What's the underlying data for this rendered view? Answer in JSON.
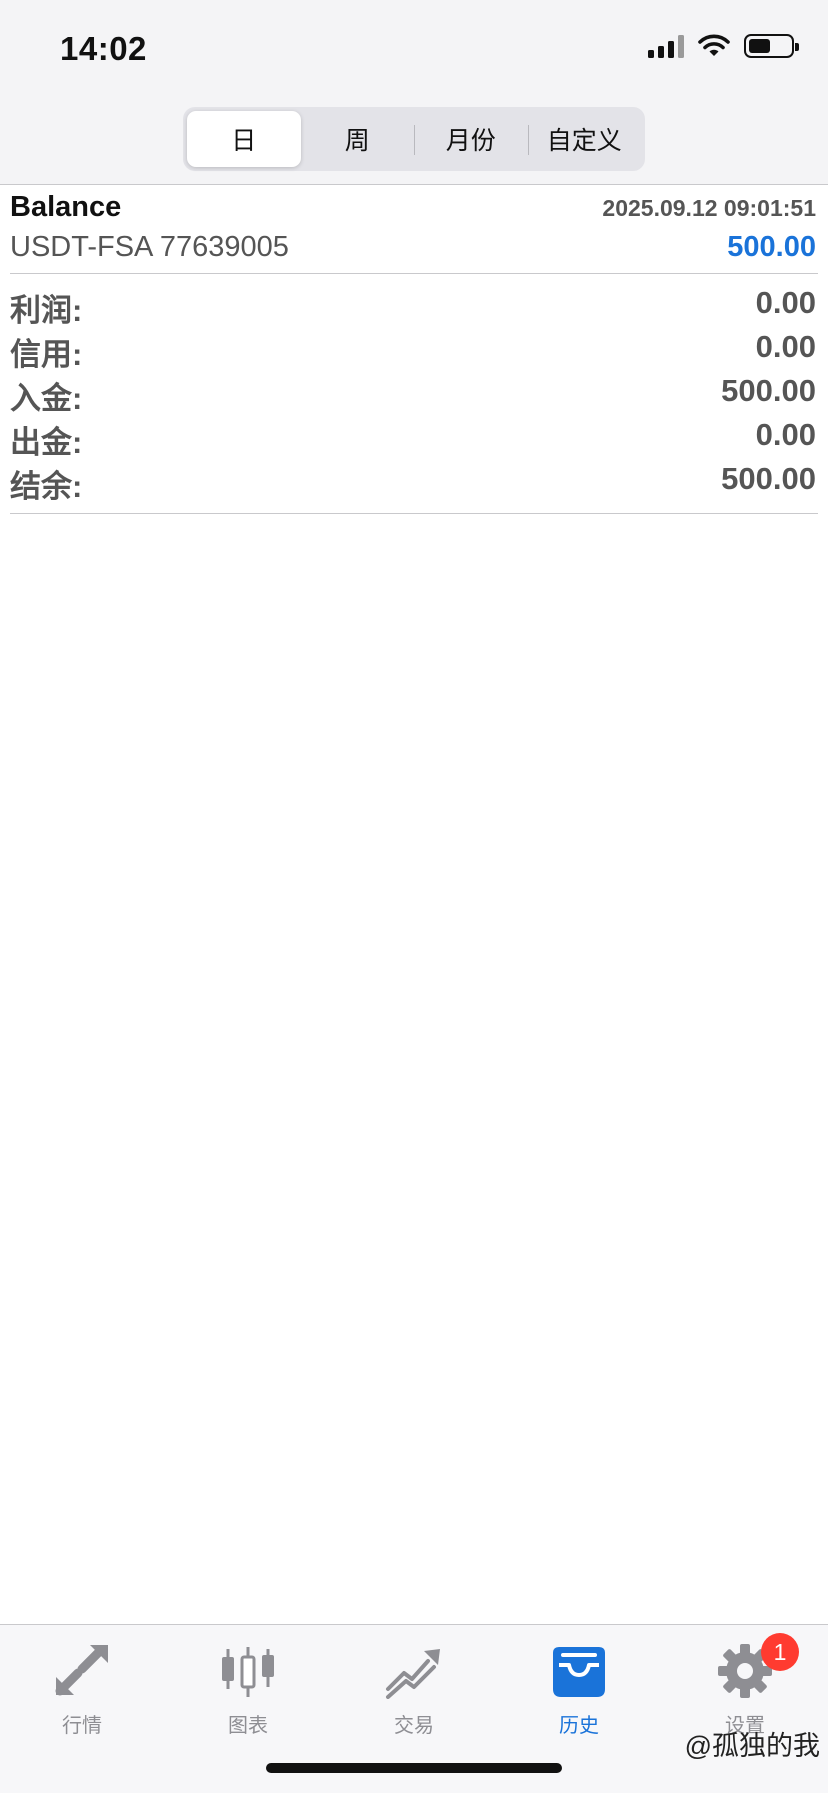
{
  "status_bar": {
    "time": "14:02"
  },
  "segments": [
    {
      "label": "日",
      "active": true
    },
    {
      "label": "周",
      "active": false
    },
    {
      "label": "月份",
      "active": false
    },
    {
      "label": "自定义",
      "active": false
    }
  ],
  "record": {
    "type": "Balance",
    "datetime": "2025.09.12 09:01:51",
    "account": "USDT-FSA 77639005",
    "amount": "500.00"
  },
  "summary": [
    {
      "label": "利润:",
      "value": "0.00"
    },
    {
      "label": "信用:",
      "value": "0.00"
    },
    {
      "label": "入金:",
      "value": "500.00"
    },
    {
      "label": "出金:",
      "value": "0.00"
    },
    {
      "label": "结余:",
      "value": "500.00"
    }
  ],
  "tabbar": [
    {
      "label": "行情",
      "icon": "quotes-arrows-icon"
    },
    {
      "label": "图表",
      "icon": "candlestick-chart-icon"
    },
    {
      "label": "交易",
      "icon": "trade-trend-icon"
    },
    {
      "label": "历史",
      "icon": "history-tray-icon",
      "active": true
    },
    {
      "label": "设置",
      "icon": "gear-icon",
      "badge": "1"
    }
  ],
  "watermark": "@孤独的我",
  "colors": {
    "accent": "#1a73d9",
    "badge": "#ff3b30",
    "text_gray": "#555555"
  }
}
